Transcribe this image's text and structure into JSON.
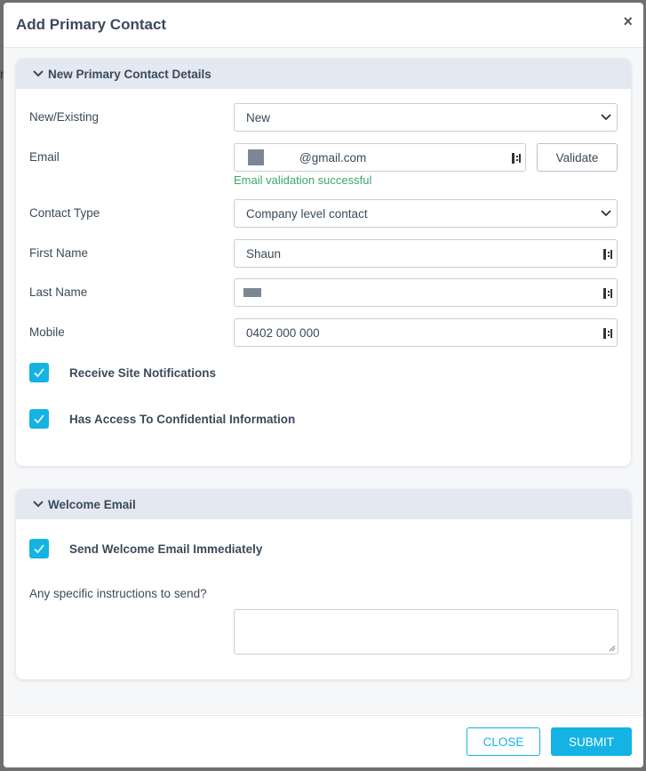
{
  "modal": {
    "title": "Add Primary Contact",
    "close_icon": "close-icon"
  },
  "section_details": {
    "title": "New Primary Contact Details",
    "fields": {
      "new_existing": {
        "label": "New/Existing",
        "value": "New"
      },
      "email": {
        "label": "Email",
        "value": "@gmail.com",
        "validate_label": "Validate",
        "status": "Email validation successful"
      },
      "contact_type": {
        "label": "Contact Type",
        "value": "Company level contact"
      },
      "first_name": {
        "label": "First Name",
        "value": "Shaun"
      },
      "last_name": {
        "label": "Last Name",
        "value": ""
      },
      "mobile": {
        "label": "Mobile",
        "value": "0402 000 000"
      }
    },
    "checkboxes": {
      "receive_site_notifications": {
        "label": "Receive Site Notifications",
        "checked": true
      },
      "confidential_access": {
        "label": "Has Access To Confidential Information",
        "checked": true
      }
    }
  },
  "section_welcome": {
    "title": "Welcome Email",
    "send_immediately": {
      "label": "Send Welcome Email Immediately",
      "checked": true
    },
    "instructions": {
      "label": "Any specific instructions to send?",
      "value": ""
    }
  },
  "footer": {
    "close_label": "CLOSE",
    "submit_label": "SUBMIT"
  },
  "colors": {
    "accent": "#14b3e4",
    "success": "#3aa96a",
    "section_header": "#e3e8f1"
  }
}
